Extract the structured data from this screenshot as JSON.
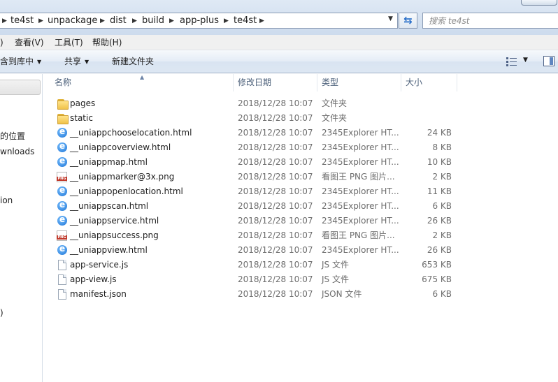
{
  "address": {
    "breadcrumbs": [
      "te4st",
      "unpackage",
      "dist",
      "build",
      "app-plus",
      "te4st"
    ],
    "search_placeholder": "搜索 te4st"
  },
  "menu": {
    "items": [
      ")",
      "查看(V)",
      "工具(T)",
      "帮助(H)"
    ]
  },
  "toolbar": {
    "include_library": "含到库中",
    "share": "共享",
    "new_folder": "新建文件夹"
  },
  "nav": {
    "items": [
      "的位置",
      "wnloads",
      "ion",
      ")"
    ]
  },
  "columns": {
    "name": "名称",
    "date": "修改日期",
    "type": "类型",
    "size": "大小"
  },
  "files": [
    {
      "name": "pages",
      "date": "2018/12/28 10:07",
      "type": "文件夹",
      "size": "",
      "icon": "folder-icon"
    },
    {
      "name": "static",
      "date": "2018/12/28 10:07",
      "type": "文件夹",
      "size": "",
      "icon": "folder-icon"
    },
    {
      "name": "__uniappchooselocation.html",
      "date": "2018/12/28 10:07",
      "type": "2345Explorer HT...",
      "size": "24 KB",
      "icon": "ie-html-icon"
    },
    {
      "name": "__uniappcoverview.html",
      "date": "2018/12/28 10:07",
      "type": "2345Explorer HT...",
      "size": "8 KB",
      "icon": "ie-html-icon"
    },
    {
      "name": "__uniappmap.html",
      "date": "2018/12/28 10:07",
      "type": "2345Explorer HT...",
      "size": "10 KB",
      "icon": "ie-html-icon"
    },
    {
      "name": "__uniappmarker@3x.png",
      "date": "2018/12/28 10:07",
      "type": "看图王 PNG 图片...",
      "size": "2 KB",
      "icon": "png-icon"
    },
    {
      "name": "__uniappopenlocation.html",
      "date": "2018/12/28 10:07",
      "type": "2345Explorer HT...",
      "size": "11 KB",
      "icon": "ie-html-icon"
    },
    {
      "name": "__uniappscan.html",
      "date": "2018/12/28 10:07",
      "type": "2345Explorer HT...",
      "size": "6 KB",
      "icon": "ie-html-icon"
    },
    {
      "name": "__uniappservice.html",
      "date": "2018/12/28 10:07",
      "type": "2345Explorer HT...",
      "size": "26 KB",
      "icon": "ie-html-icon"
    },
    {
      "name": "__uniappsuccess.png",
      "date": "2018/12/28 10:07",
      "type": "看图王 PNG 图片...",
      "size": "2 KB",
      "icon": "png-icon"
    },
    {
      "name": "__uniappview.html",
      "date": "2018/12/28 10:07",
      "type": "2345Explorer HT...",
      "size": "26 KB",
      "icon": "ie-html-icon"
    },
    {
      "name": "app-service.js",
      "date": "2018/12/28 10:07",
      "type": "JS 文件",
      "size": "653 KB",
      "icon": "js-file-icon"
    },
    {
      "name": "app-view.js",
      "date": "2018/12/28 10:07",
      "type": "JS 文件",
      "size": "675 KB",
      "icon": "js-file-icon"
    },
    {
      "name": "manifest.json",
      "date": "2018/12/28 10:07",
      "type": "JSON 文件",
      "size": "6 KB",
      "icon": "json-file-icon"
    }
  ]
}
